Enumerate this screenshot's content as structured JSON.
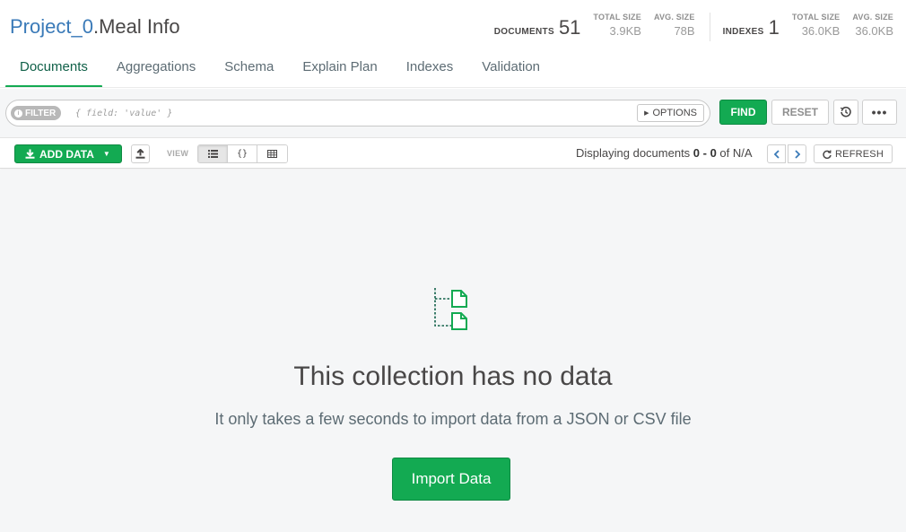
{
  "header": {
    "db_name": "Project_0",
    "collection_name": ".Meal Info",
    "documents_label": "DOCUMENTS",
    "documents_count": "51",
    "doc_total_size_label": "TOTAL SIZE",
    "doc_total_size": "3.9KB",
    "doc_avg_size_label": "AVG. SIZE",
    "doc_avg_size": "78B",
    "indexes_label": "INDEXES",
    "indexes_count": "1",
    "idx_total_size_label": "TOTAL SIZE",
    "idx_total_size": "36.0KB",
    "idx_avg_size_label": "AVG. SIZE",
    "idx_avg_size": "36.0KB"
  },
  "tabs": [
    {
      "label": "Documents",
      "active": true
    },
    {
      "label": "Aggregations"
    },
    {
      "label": "Schema"
    },
    {
      "label": "Explain Plan"
    },
    {
      "label": "Indexes"
    },
    {
      "label": "Validation"
    }
  ],
  "filter": {
    "pill_label": "FILTER",
    "placeholder": "{ field: 'value' }",
    "options_label": "OPTIONS",
    "find_label": "FIND",
    "reset_label": "RESET",
    "more_label": "•••"
  },
  "toolbar": {
    "add_data_label": "ADD DATA",
    "view_label": "VIEW",
    "view_json_label": "{}",
    "display_prefix": "Displaying documents ",
    "display_range": "0 - 0",
    "display_of": " of ",
    "display_total": "N/A",
    "refresh_label": "REFRESH"
  },
  "empty_state": {
    "title": "This collection has no data",
    "subtitle": "It only takes a few seconds to import data from a JSON or CSV file",
    "import_label": "Import Data"
  },
  "colors": {
    "accent": "#13aa52",
    "db_link": "#3a7ab8",
    "active_tab_text": "#116149"
  },
  "icons": {
    "history": "history-icon",
    "upload": "upload-icon",
    "download": "download-icon",
    "list_view": "list-view-icon",
    "table_view": "table-view-icon",
    "chevron_left": "chevron-left-icon",
    "chevron_right": "chevron-right-icon",
    "refresh": "refresh-icon",
    "empty_docs": "documents-icon"
  }
}
